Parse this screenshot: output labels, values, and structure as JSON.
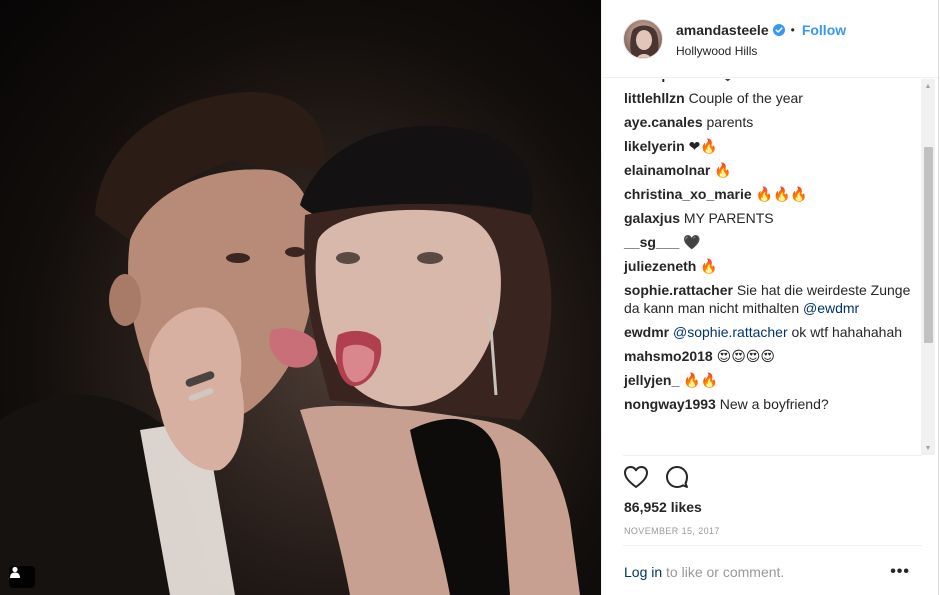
{
  "post": {
    "username": "amandasteele",
    "separator": "•",
    "follow_label": "Follow",
    "location": "Hollywood Hills",
    "likes": "86,952 likes",
    "date": "NOVEMBER 15, 2017",
    "login_link": "Log in",
    "login_suffix": " to like or comment.",
    "more_label": "•••",
    "photo_alt": "Photo"
  },
  "comments": [
    {
      "author": "sarahpeaurce",
      "text": "🖤"
    },
    {
      "author": "littlehllzn",
      "text": "Couple of the year"
    },
    {
      "author": "aye.canales",
      "text": "parents"
    },
    {
      "author": "likelyerin",
      "text": "❤🔥"
    },
    {
      "author": "elainamolnar",
      "text": "🔥"
    },
    {
      "author": "christina_xo_marie",
      "text": "🔥🔥🔥"
    },
    {
      "author": "galaxjus",
      "text": "MY PARENTS"
    },
    {
      "author": "__sg___",
      "text": "🖤"
    },
    {
      "author": "juliezeneth",
      "text": "🔥"
    },
    {
      "author": "sophie.rattacher",
      "text": "Sie hat die weirdeste Zunge da kann man nicht mithalten ",
      "mention": "@ewdmr",
      "after": ""
    },
    {
      "author": "ewdmr",
      "text": "",
      "mention": "@sophie.rattacher",
      "after": " ok wtf hahahahah"
    },
    {
      "author": "mahsmo2018",
      "text": "😍😍😍😍"
    },
    {
      "author": "jellyjen_",
      "text": "🔥🔥"
    },
    {
      "author": "nongway1993",
      "text": "New a boyfriend?"
    }
  ],
  "icons": {
    "verified": "verified-badge-icon",
    "heart": "heart-outline-icon",
    "comment": "comment-bubble-icon",
    "user_tag": "user-tag-icon",
    "scroll_up": "▲",
    "scroll_down": "▼"
  },
  "colors": {
    "link_blue": "#3897f0",
    "text": "#262626",
    "muted": "#999999",
    "mention": "#003569"
  }
}
